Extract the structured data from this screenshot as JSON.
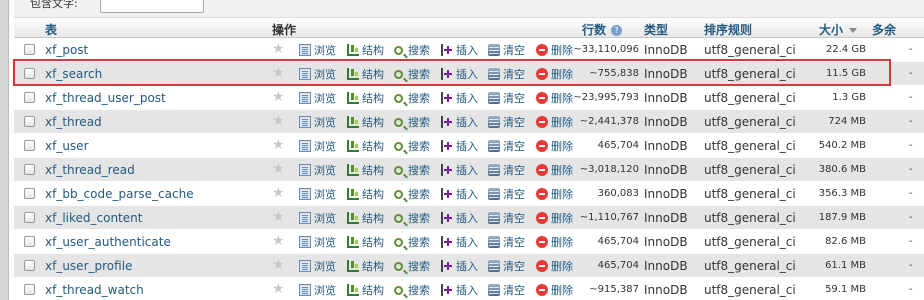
{
  "filter": {
    "label": "包含文字:",
    "value": ""
  },
  "columns": {
    "table": "表",
    "action": "操作",
    "rows": "行数",
    "type": "类型",
    "collation": "排序规则",
    "size": "大小",
    "overhead": "多余"
  },
  "actions": {
    "browse": "浏览",
    "structure": "结构",
    "search": "搜索",
    "insert": "插入",
    "empty": "清空",
    "drop": "删除"
  },
  "rows": [
    {
      "name": "xf_post",
      "rows": "~33,110,096",
      "type": "InnoDB",
      "collation": "utf8_general_ci",
      "size": "22.4 GB",
      "overhead": "-"
    },
    {
      "name": "xf_search",
      "rows": "~755,838",
      "type": "InnoDB",
      "collation": "utf8_general_ci",
      "size": "11.5 GB",
      "overhead": "-"
    },
    {
      "name": "xf_thread_user_post",
      "rows": "~23,995,793",
      "type": "InnoDB",
      "collation": "utf8_general_ci",
      "size": "1.3 GB",
      "overhead": "-"
    },
    {
      "name": "xf_thread",
      "rows": "~2,441,378",
      "type": "InnoDB",
      "collation": "utf8_general_ci",
      "size": "724 MB",
      "overhead": "-"
    },
    {
      "name": "xf_user",
      "rows": "465,704",
      "type": "InnoDB",
      "collation": "utf8_general_ci",
      "size": "540.2 MB",
      "overhead": "-"
    },
    {
      "name": "xf_thread_read",
      "rows": "~3,018,120",
      "type": "InnoDB",
      "collation": "utf8_general_ci",
      "size": "380.6 MB",
      "overhead": "-"
    },
    {
      "name": "xf_bb_code_parse_cache",
      "rows": "360,083",
      "type": "InnoDB",
      "collation": "utf8_general_ci",
      "size": "356.3 MB",
      "overhead": "-"
    },
    {
      "name": "xf_liked_content",
      "rows": "~1,110,767",
      "type": "InnoDB",
      "collation": "utf8_general_ci",
      "size": "187.9 MB",
      "overhead": "-"
    },
    {
      "name": "xf_user_authenticate",
      "rows": "465,704",
      "type": "InnoDB",
      "collation": "utf8_general_ci",
      "size": "82.6 MB",
      "overhead": "-"
    },
    {
      "name": "xf_user_profile",
      "rows": "465,704",
      "type": "InnoDB",
      "collation": "utf8_general_ci",
      "size": "61.1 MB",
      "overhead": "-"
    },
    {
      "name": "xf_thread_watch",
      "rows": "~915,387",
      "type": "InnoDB",
      "collation": "utf8_general_ci",
      "size": "59.1 MB",
      "overhead": "-"
    }
  ],
  "highlighted_row": "xf_search",
  "colors": {
    "link": "#235a81",
    "highlight_border": "#d9363e",
    "row_alt": "#e5e5e5"
  }
}
